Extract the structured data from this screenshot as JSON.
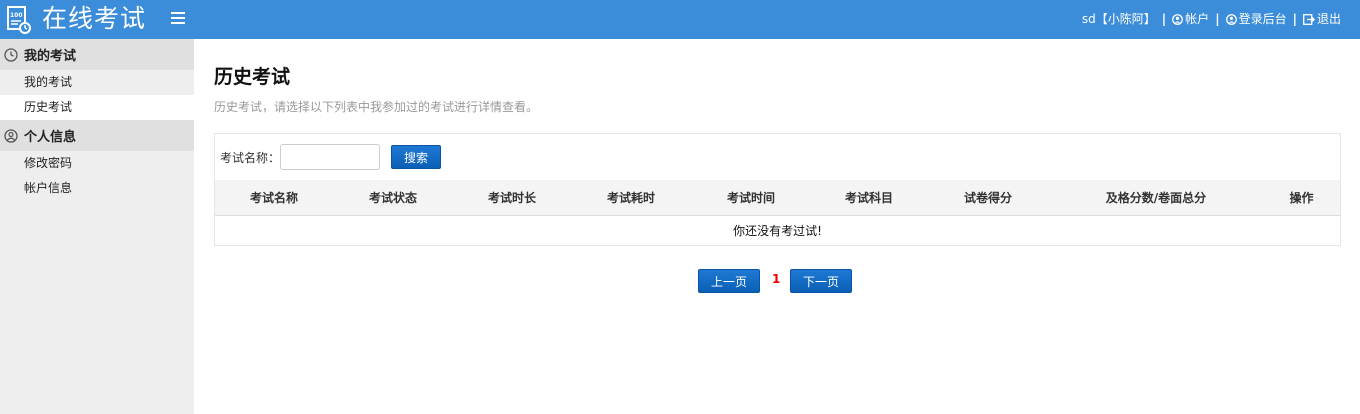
{
  "header": {
    "app_title": "在线考试",
    "user_label": "sd【小陈阿】",
    "account_label": "帐户",
    "admin_label": "登录后台",
    "logout_label": "退出",
    "separator": "|"
  },
  "sidebar": {
    "groups": [
      {
        "title": "我的考试",
        "icon": "clock-icon",
        "items": [
          {
            "label": "我的考试"
          },
          {
            "label": "历史考试",
            "active": true
          }
        ]
      },
      {
        "title": "个人信息",
        "icon": "user-icon",
        "items": [
          {
            "label": "修改密码"
          },
          {
            "label": "帐户信息"
          }
        ]
      }
    ]
  },
  "main": {
    "title": "历史考试",
    "description": "历史考试，请选择以下列表中我参加过的考试进行详情查看。",
    "search": {
      "label": "考试名称：",
      "value": "",
      "placeholder": "",
      "button": "搜索"
    },
    "table": {
      "columns": [
        "考试名称",
        "考试状态",
        "考试时长",
        "考试耗时",
        "考试时间",
        "考试科目",
        "试卷得分",
        "及格分数/卷面总分",
        "操作"
      ],
      "empty_text": "你还没有考过试!"
    },
    "pager": {
      "prev": "上一页",
      "page": "1",
      "next": "下一页"
    }
  },
  "colors": {
    "header_bg": "#3c8dd9",
    "button": "#0b5fb5",
    "page_number": "#ee0000"
  }
}
